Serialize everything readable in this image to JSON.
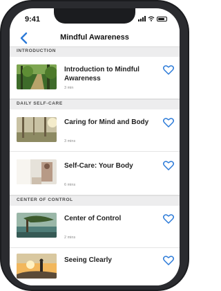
{
  "status": {
    "time": "9:41"
  },
  "nav": {
    "title": "Mindful Awareness"
  },
  "sections": [
    {
      "label": "INTRODUCTION"
    },
    {
      "label": "DAILY SELF-CARE"
    },
    {
      "label": "CENTER OF CONTROL"
    }
  ],
  "items": [
    {
      "title": "Introduction to Mindful Awareness",
      "duration": "3 min",
      "thumb": "forest-path"
    },
    {
      "title": "Caring for Mind and Body",
      "duration": "3 mins",
      "thumb": "sunlit-trees"
    },
    {
      "title": "Self-Care: Your Body",
      "duration": "6 mins",
      "thumb": "bright-interior"
    },
    {
      "title": "Center of Control",
      "duration": "2 mins",
      "thumb": "tree-over-water"
    },
    {
      "title": "Seeing Clearly",
      "duration": "",
      "thumb": "hiker-sunset"
    }
  ],
  "icons": {
    "back": "chevron-left-icon",
    "favorite": "heart-outline-icon"
  },
  "colors": {
    "accent": "#2b7ad8",
    "section_bg": "#ededee"
  }
}
